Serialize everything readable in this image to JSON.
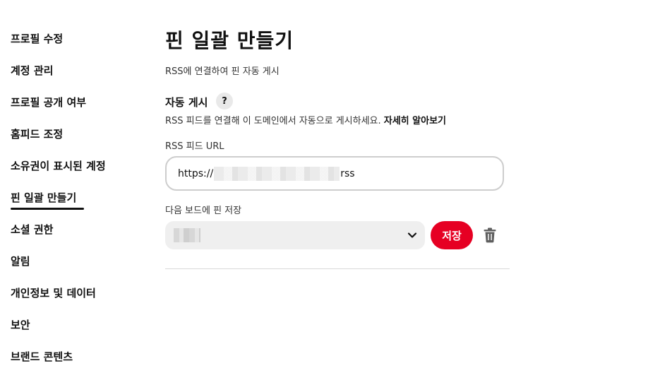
{
  "sidebar": {
    "items": [
      {
        "label": "프로필 수정"
      },
      {
        "label": "계정 관리"
      },
      {
        "label": "프로필 공개 여부"
      },
      {
        "label": "홈피드 조정"
      },
      {
        "label": "소유권이 표시된 계정"
      },
      {
        "label": "핀 일괄 만들기"
      },
      {
        "label": "소셜 권한"
      },
      {
        "label": "알림"
      },
      {
        "label": "개인정보 및 데이터"
      },
      {
        "label": "보안"
      },
      {
        "label": "브랜드 콘텐츠"
      }
    ],
    "active_index": 5
  },
  "main": {
    "title": "핀 일괄 만들기",
    "subtitle": "RSS에 연결하여 핀 자동 게시",
    "section": {
      "title": "자동 게시",
      "help_icon": "?",
      "description": "RSS 피드를 연결해 이 도메인에서 자동으로 게시하세요.",
      "learn_more": "자세히 알아보기"
    },
    "rss_field": {
      "label": "RSS 피드 URL",
      "value_prefix": "https://",
      "value_suffix": "rss"
    },
    "board_field": {
      "label": "다음 보드에 핀 저장"
    },
    "save_label": "저장",
    "icons": {
      "dropdown": "chevron-down-icon",
      "delete": "trash-icon"
    },
    "colors": {
      "accent": "#e60023"
    }
  }
}
